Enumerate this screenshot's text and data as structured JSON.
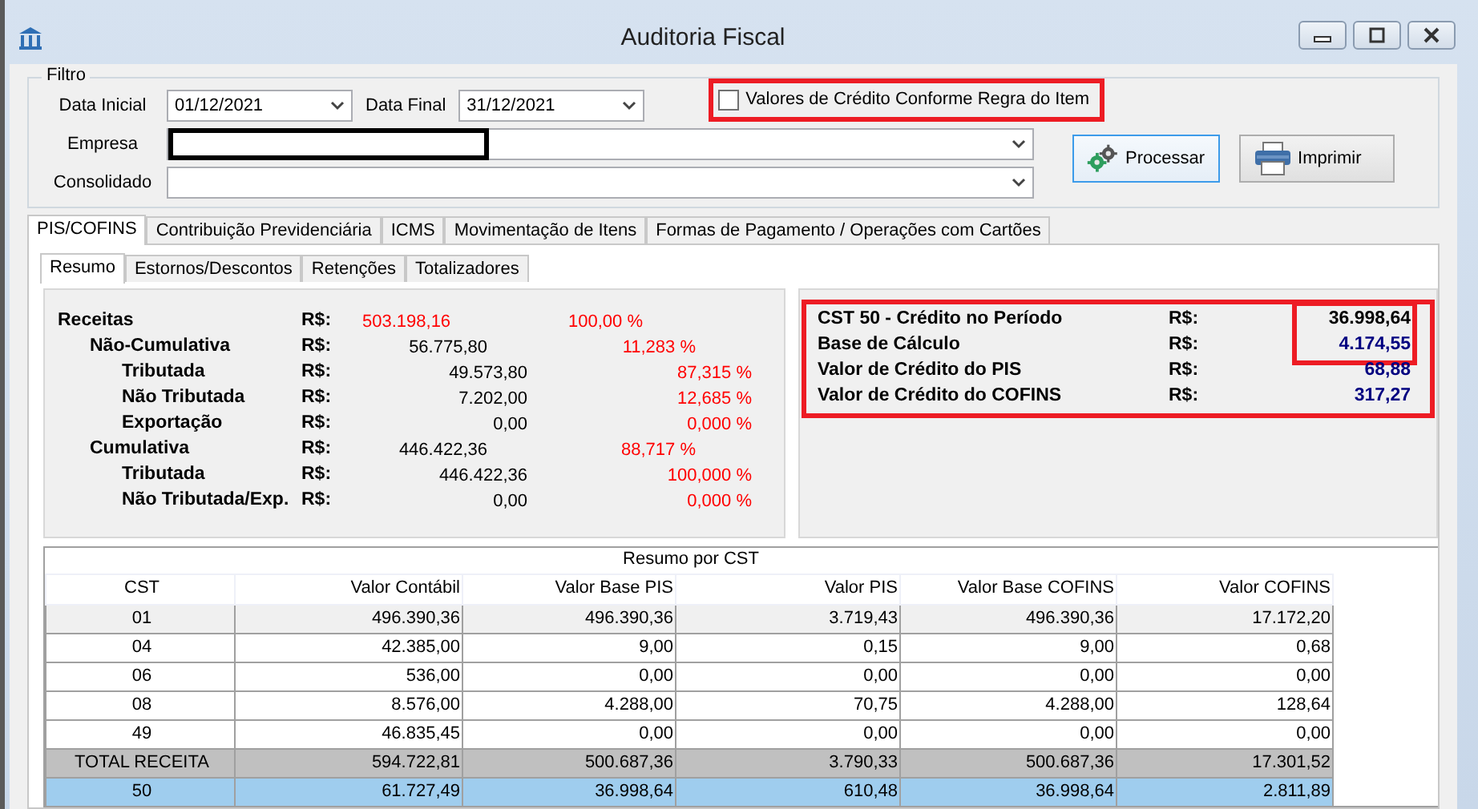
{
  "window": {
    "title": "Auditoria Fiscal"
  },
  "filter": {
    "legend": "Filtro",
    "date_start": {
      "label": "Data Inicial",
      "value": "01/12/2021"
    },
    "date_end": {
      "label": "Data Final",
      "value": "31/12/2021"
    },
    "credit_rule_checkbox": {
      "label": "Valores de Crédito Conforme Regra do Item",
      "checked": false,
      "highlighted": true
    },
    "empresa": {
      "label": "Empresa",
      "redacted": true
    },
    "consolidado": {
      "label": "Consolidado"
    }
  },
  "buttons": [
    {
      "label": "Processar",
      "kind": "process",
      "focused": true
    },
    {
      "label": "Imprimir",
      "kind": "print",
      "focused": false
    }
  ],
  "tabs": [
    {
      "label": "PIS/COFINS",
      "selected": true
    },
    {
      "label": "Contribuição Previdenciária",
      "selected": false
    },
    {
      "label": "ICMS",
      "selected": false
    },
    {
      "label": "Movimentação de Itens",
      "selected": false
    },
    {
      "label": "Formas de Pagamento / Operações com Cartões",
      "selected": false
    }
  ],
  "subtabs": [
    {
      "label": "Resumo",
      "selected": true
    },
    {
      "label": "Estornos/Descontos",
      "selected": false
    },
    {
      "label": "Retenções",
      "selected": false
    },
    {
      "label": "Totalizadores",
      "selected": false
    }
  ],
  "summary": [
    {
      "label": "Receitas",
      "currency": "R$:",
      "value": "503.198,16",
      "percent": "100,00 %",
      "children": [
        {
          "label": "Não-Cumulativa",
          "currency": "R$:",
          "value": "56.775,80",
          "percent": "11,283 %",
          "children": [
            {
              "label": "Tributada",
              "currency": "R$:",
              "value": "49.573,80",
              "percent": "87,315 %"
            },
            {
              "label": "Não Tributada",
              "currency": "R$:",
              "value": "7.202,00",
              "percent": "12,685 %"
            },
            {
              "label": "Exportação",
              "currency": "R$:",
              "value": "0,00",
              "percent": "0,000 %"
            }
          ]
        },
        {
          "label": "Cumulativa",
          "currency": "R$:",
          "value": "446.422,36",
          "percent": "88,717 %",
          "children": [
            {
              "label": "Tributada",
              "currency": "R$:",
              "value": "446.422,36",
              "percent": "100,000 %"
            },
            {
              "label": "Não Tributada/Exp.",
              "currency": "R$:",
              "value": "0,00",
              "percent": "0,000 %"
            }
          ]
        }
      ]
    }
  ],
  "credit_panel": {
    "highlighted": true,
    "rows": [
      {
        "label": "CST 50 - Crédito no Período",
        "currency": "R$:",
        "value": "36.998,64",
        "color": "#000000",
        "highlighted": true
      },
      {
        "label": "Base de Cálculo",
        "currency": "R$:",
        "value": "4.174,55",
        "color": "#000080",
        "highlighted": true
      },
      {
        "label": "Valor de Crédito do PIS",
        "currency": "R$:",
        "value": "68,88",
        "color": "#000080",
        "highlighted": false
      },
      {
        "label": "Valor de Crédito do COFINS",
        "currency": "R$:",
        "value": "317,27",
        "color": "#000080",
        "highlighted": false
      }
    ]
  },
  "table": {
    "title": "Resumo por CST",
    "columns": [
      "CST",
      "Valor Contábil",
      "Valor Base PIS",
      "Valor PIS",
      "Valor Base COFINS",
      "Valor COFINS"
    ],
    "rows": [
      {
        "kind": "current",
        "cells": [
          "01",
          "496.390,36",
          "496.390,36",
          "3.719,43",
          "496.390,36",
          "17.172,20"
        ]
      },
      {
        "kind": "data",
        "cells": [
          "04",
          "42.385,00",
          "9,00",
          "0,15",
          "9,00",
          "0,68"
        ]
      },
      {
        "kind": "data",
        "cells": [
          "06",
          "536,00",
          "0,00",
          "0,00",
          "0,00",
          "0,00"
        ]
      },
      {
        "kind": "data",
        "cells": [
          "08",
          "8.576,00",
          "4.288,00",
          "70,75",
          "4.288,00",
          "128,64"
        ]
      },
      {
        "kind": "data",
        "cells": [
          "49",
          "46.835,45",
          "0,00",
          "0,00",
          "0,00",
          "0,00"
        ]
      },
      {
        "kind": "total",
        "cells": [
          "TOTAL RECEITA",
          "594.722,81",
          "500.687,36",
          "3.790,33",
          "500.687,36",
          "17.301,52"
        ]
      },
      {
        "kind": "credit",
        "cells": [
          "50",
          "61.727,49",
          "36.998,64",
          "610,48",
          "36.998,64",
          "2.811,89"
        ]
      }
    ]
  }
}
